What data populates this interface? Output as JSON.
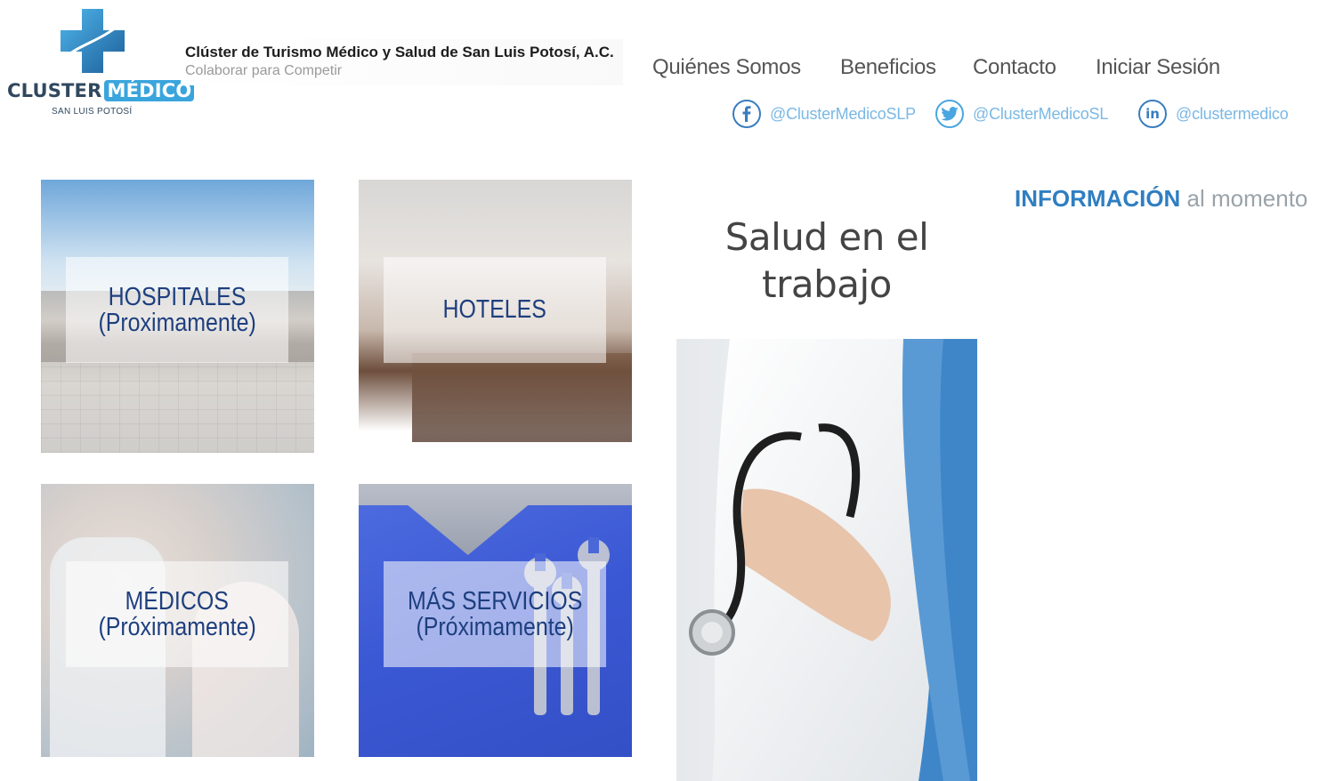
{
  "brand": {
    "logo_word_1": "CLUSTER",
    "logo_word_2": "MÉDICO",
    "logo_sub": "SAN LUIS POTOSÍ",
    "title": "Clúster de Turismo Médico y Salud de San Luis Potosí, A.C.",
    "tagline": "Colaborar para Competir"
  },
  "nav": {
    "items": [
      {
        "label": "Quiénes Somos"
      },
      {
        "label": "Beneficios"
      },
      {
        "label": "Contacto"
      },
      {
        "label": "Iniciar Sesión"
      }
    ]
  },
  "social": [
    {
      "network": "facebook",
      "icon": "facebook-icon",
      "handle": "@ClusterMedicoSLP"
    },
    {
      "network": "twitter",
      "icon": "twitter-icon",
      "handle": "@ClusterMedicoSL"
    },
    {
      "network": "linkedin",
      "icon": "linkedin-icon",
      "handle": "@clustermedico"
    }
  ],
  "tiles": [
    {
      "line1": "HOSPITALES",
      "line2": "(Proximamente)"
    },
    {
      "line1": "HOTELES",
      "line2": ""
    },
    {
      "line1": "MÉDICOS",
      "line2": "(Próximamente)"
    },
    {
      "line1": "MÁS SERVICIOS",
      "line2": "(Próximamente)"
    }
  ],
  "feature": {
    "title_line1": "Salud en el",
    "title_line2": "trabajo"
  },
  "info": {
    "strong": "INFORMACIÓN",
    "light": " al momento"
  },
  "colors": {
    "accent": "#2f7ec1",
    "logo_blue": "#3aa5dc",
    "tile_text": "#1e3f7f",
    "social_handle": "#7ab8e4"
  }
}
